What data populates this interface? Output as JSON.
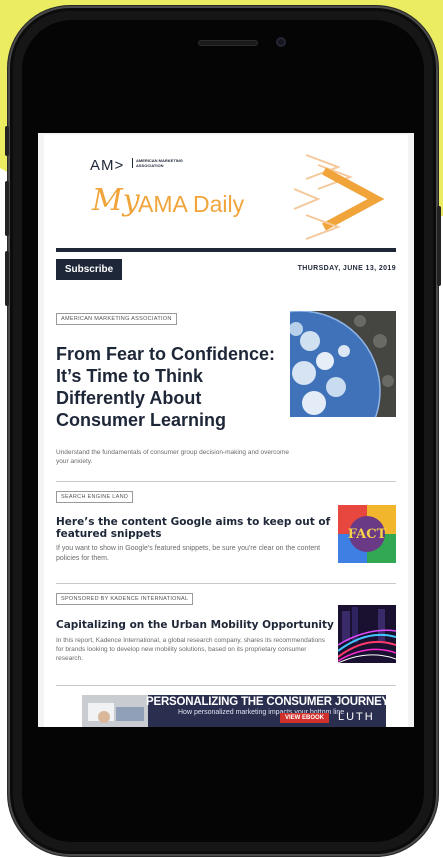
{
  "newsletter": {
    "brand_mark": "AM>",
    "brand_org": "AMERICAN MARKETING ASSOCIATION",
    "title_script": "My",
    "title": "AMA Daily",
    "subscribe_label": "Subscribe",
    "date": "THURSDAY, JUNE 13, 2019"
  },
  "articles": [
    {
      "source": "AMERICAN MARKETING ASSOCIATION",
      "title": "From Fear to Confidence: It’s Time to Think Differently About Consumer Learning",
      "summary": "Understand the fundamentals of consumer group decision-making and overcome your anxiety."
    },
    {
      "source": "SEARCH ENGINE LAND",
      "title": "Here’s the content Google aims to keep out of featured snippets",
      "summary": "If you want to show in Google’s featured snippets, be sure you’re clear on the content policies for them.",
      "thumb_text": "FACT"
    },
    {
      "source": "SPONSORED BY KADENCE INTERNATIONAL",
      "title": "Capitalizing on the Urban Mobility Opportunity",
      "summary": "In this report, Kadence International, a global research company, shares its recommendations for brands looking to develop new mobility solutions, based on its proprietary consumer research."
    }
  ],
  "banner": {
    "title": "PERSONALIZING THE CONSUMER JOURNEY",
    "subtitle": "How personalized marketing impacts your bottom line",
    "cta": "VIEW EBOOK",
    "brand": "LUTH"
  },
  "colors": {
    "navy": "#1e2738",
    "orange": "#f0a43a",
    "yellow_bg": "#ecec62"
  }
}
